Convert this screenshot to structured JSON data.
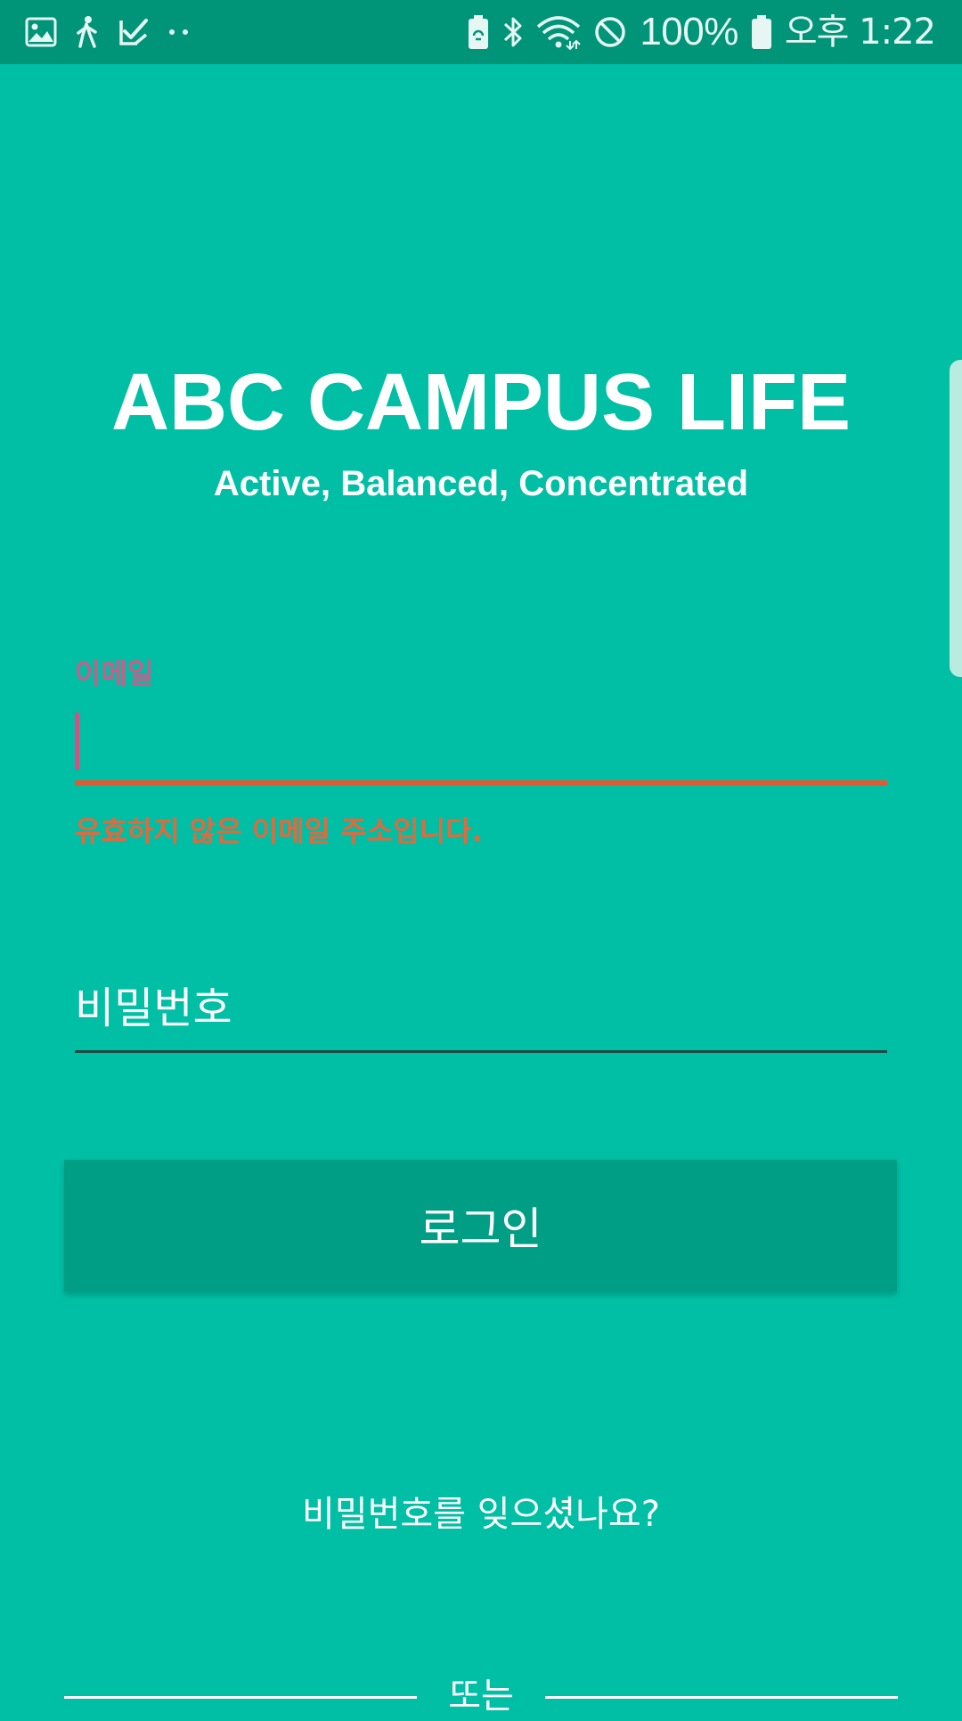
{
  "status_bar": {
    "left_icons": [
      "gallery-icon",
      "walking-icon",
      "task-check-icon",
      "more-dots-icon"
    ],
    "right_icons": [
      "battery-saver-icon",
      "bluetooth-icon",
      "wifi-icon",
      "do-not-disturb-icon",
      "battery-icon"
    ],
    "battery_percent": "100%",
    "time": "오후 1:22"
  },
  "header": {
    "title": "ABC CAMPUS LIFE",
    "subtitle": "Active, Balanced, Concentrated"
  },
  "email": {
    "label": "이메일",
    "value": "",
    "error": "유효하지 않은 이메일 주소입니다."
  },
  "password": {
    "placeholder": "비밀번호",
    "value": ""
  },
  "login_button": "로그인",
  "forgot_password": "비밀번호를 잊으셨나요?",
  "divider_text": "또는",
  "colors": {
    "background": "#00BFA5",
    "status_bar": "#009479",
    "button": "#009E85",
    "error": "#E35A32",
    "email_label": "#D05A8A",
    "cursor": "#D94F82"
  }
}
